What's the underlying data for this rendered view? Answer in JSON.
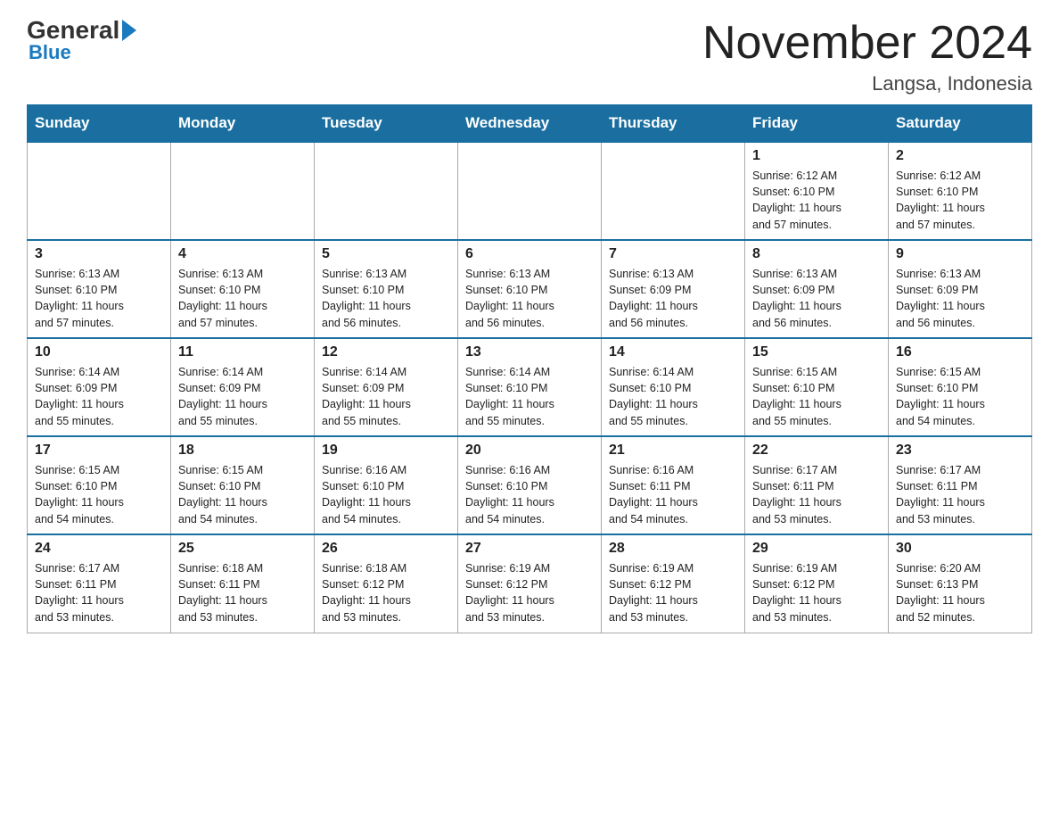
{
  "logo": {
    "general": "General",
    "blue": "Blue",
    "line2": "Blue"
  },
  "header": {
    "title": "November 2024",
    "subtitle": "Langsa, Indonesia"
  },
  "weekdays": [
    "Sunday",
    "Monday",
    "Tuesday",
    "Wednesday",
    "Thursday",
    "Friday",
    "Saturday"
  ],
  "weeks": [
    [
      {
        "day": "",
        "info": ""
      },
      {
        "day": "",
        "info": ""
      },
      {
        "day": "",
        "info": ""
      },
      {
        "day": "",
        "info": ""
      },
      {
        "day": "",
        "info": ""
      },
      {
        "day": "1",
        "info": "Sunrise: 6:12 AM\nSunset: 6:10 PM\nDaylight: 11 hours\nand 57 minutes."
      },
      {
        "day": "2",
        "info": "Sunrise: 6:12 AM\nSunset: 6:10 PM\nDaylight: 11 hours\nand 57 minutes."
      }
    ],
    [
      {
        "day": "3",
        "info": "Sunrise: 6:13 AM\nSunset: 6:10 PM\nDaylight: 11 hours\nand 57 minutes."
      },
      {
        "day": "4",
        "info": "Sunrise: 6:13 AM\nSunset: 6:10 PM\nDaylight: 11 hours\nand 57 minutes."
      },
      {
        "day": "5",
        "info": "Sunrise: 6:13 AM\nSunset: 6:10 PM\nDaylight: 11 hours\nand 56 minutes."
      },
      {
        "day": "6",
        "info": "Sunrise: 6:13 AM\nSunset: 6:10 PM\nDaylight: 11 hours\nand 56 minutes."
      },
      {
        "day": "7",
        "info": "Sunrise: 6:13 AM\nSunset: 6:09 PM\nDaylight: 11 hours\nand 56 minutes."
      },
      {
        "day": "8",
        "info": "Sunrise: 6:13 AM\nSunset: 6:09 PM\nDaylight: 11 hours\nand 56 minutes."
      },
      {
        "day": "9",
        "info": "Sunrise: 6:13 AM\nSunset: 6:09 PM\nDaylight: 11 hours\nand 56 minutes."
      }
    ],
    [
      {
        "day": "10",
        "info": "Sunrise: 6:14 AM\nSunset: 6:09 PM\nDaylight: 11 hours\nand 55 minutes."
      },
      {
        "day": "11",
        "info": "Sunrise: 6:14 AM\nSunset: 6:09 PM\nDaylight: 11 hours\nand 55 minutes."
      },
      {
        "day": "12",
        "info": "Sunrise: 6:14 AM\nSunset: 6:09 PM\nDaylight: 11 hours\nand 55 minutes."
      },
      {
        "day": "13",
        "info": "Sunrise: 6:14 AM\nSunset: 6:10 PM\nDaylight: 11 hours\nand 55 minutes."
      },
      {
        "day": "14",
        "info": "Sunrise: 6:14 AM\nSunset: 6:10 PM\nDaylight: 11 hours\nand 55 minutes."
      },
      {
        "day": "15",
        "info": "Sunrise: 6:15 AM\nSunset: 6:10 PM\nDaylight: 11 hours\nand 55 minutes."
      },
      {
        "day": "16",
        "info": "Sunrise: 6:15 AM\nSunset: 6:10 PM\nDaylight: 11 hours\nand 54 minutes."
      }
    ],
    [
      {
        "day": "17",
        "info": "Sunrise: 6:15 AM\nSunset: 6:10 PM\nDaylight: 11 hours\nand 54 minutes."
      },
      {
        "day": "18",
        "info": "Sunrise: 6:15 AM\nSunset: 6:10 PM\nDaylight: 11 hours\nand 54 minutes."
      },
      {
        "day": "19",
        "info": "Sunrise: 6:16 AM\nSunset: 6:10 PM\nDaylight: 11 hours\nand 54 minutes."
      },
      {
        "day": "20",
        "info": "Sunrise: 6:16 AM\nSunset: 6:10 PM\nDaylight: 11 hours\nand 54 minutes."
      },
      {
        "day": "21",
        "info": "Sunrise: 6:16 AM\nSunset: 6:11 PM\nDaylight: 11 hours\nand 54 minutes."
      },
      {
        "day": "22",
        "info": "Sunrise: 6:17 AM\nSunset: 6:11 PM\nDaylight: 11 hours\nand 53 minutes."
      },
      {
        "day": "23",
        "info": "Sunrise: 6:17 AM\nSunset: 6:11 PM\nDaylight: 11 hours\nand 53 minutes."
      }
    ],
    [
      {
        "day": "24",
        "info": "Sunrise: 6:17 AM\nSunset: 6:11 PM\nDaylight: 11 hours\nand 53 minutes."
      },
      {
        "day": "25",
        "info": "Sunrise: 6:18 AM\nSunset: 6:11 PM\nDaylight: 11 hours\nand 53 minutes."
      },
      {
        "day": "26",
        "info": "Sunrise: 6:18 AM\nSunset: 6:12 PM\nDaylight: 11 hours\nand 53 minutes."
      },
      {
        "day": "27",
        "info": "Sunrise: 6:19 AM\nSunset: 6:12 PM\nDaylight: 11 hours\nand 53 minutes."
      },
      {
        "day": "28",
        "info": "Sunrise: 6:19 AM\nSunset: 6:12 PM\nDaylight: 11 hours\nand 53 minutes."
      },
      {
        "day": "29",
        "info": "Sunrise: 6:19 AM\nSunset: 6:12 PM\nDaylight: 11 hours\nand 53 minutes."
      },
      {
        "day": "30",
        "info": "Sunrise: 6:20 AM\nSunset: 6:13 PM\nDaylight: 11 hours\nand 52 minutes."
      }
    ]
  ],
  "colors": {
    "header_bg": "#1a6fa0",
    "header_text": "#ffffff",
    "border": "#aaaaaa",
    "text": "#222222"
  }
}
